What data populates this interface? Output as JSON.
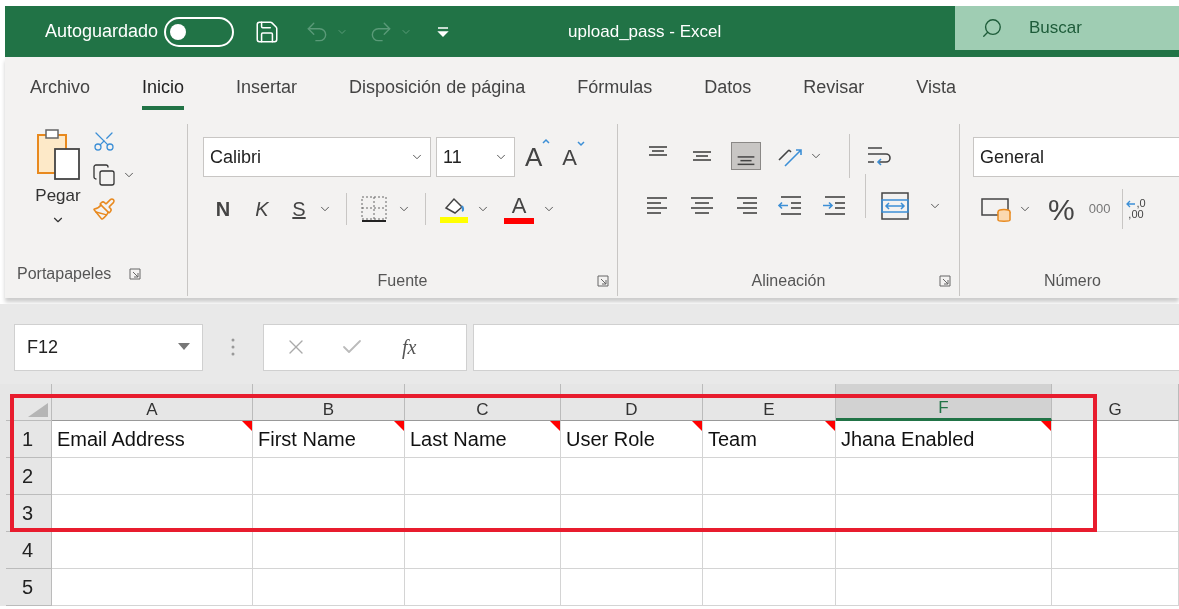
{
  "title_bar": {
    "autosave_label": "Autoguardado",
    "autosave_on": false,
    "undo_disabled": true,
    "redo_disabled": true,
    "title": "upload_pass  -  Excel",
    "search_label": "Buscar"
  },
  "tabs": [
    {
      "label": "Archivo",
      "selected": false
    },
    {
      "label": "Inicio",
      "selected": true
    },
    {
      "label": "Insertar",
      "selected": false
    },
    {
      "label": "Disposición de página",
      "selected": false
    },
    {
      "label": "Fórmulas",
      "selected": false
    },
    {
      "label": "Datos",
      "selected": false
    },
    {
      "label": "Revisar",
      "selected": false
    },
    {
      "label": "Vista",
      "selected": false
    }
  ],
  "ribbon": {
    "clipboard": {
      "paste_label": "Pegar",
      "group_label": "Portapapeles"
    },
    "font": {
      "font_name": "Calibri",
      "font_size": "11",
      "grow_label": "A",
      "shrink_label": "A",
      "bold_label": "N",
      "italic_label": "K",
      "underline_label": "S",
      "font_color_label": "A",
      "group_label": "Fuente"
    },
    "alignment": {
      "vertical": [
        {
          "kind": "top",
          "selected": false
        },
        {
          "kind": "middle",
          "selected": false
        },
        {
          "kind": "bottom",
          "selected": true
        }
      ],
      "group_label": "Alineación"
    },
    "number": {
      "format": "General",
      "percent_label": "%",
      "thousands_label": "000",
      "decimal_top": ",0",
      "decimal_bottom": ",00",
      "group_label": "Número"
    }
  },
  "formula_bar": {
    "name_box": "F12",
    "fx_label": "fx"
  },
  "sheet": {
    "columns": [
      {
        "label": "A",
        "selected": false
      },
      {
        "label": "B",
        "selected": false
      },
      {
        "label": "C",
        "selected": false
      },
      {
        "label": "D",
        "selected": false
      },
      {
        "label": "E",
        "selected": false
      },
      {
        "label": "F",
        "selected": true
      },
      {
        "label": "G",
        "selected": false
      }
    ],
    "rows": [
      {
        "label": "1",
        "cells": [
          {
            "text": "Email Address",
            "comment": true
          },
          {
            "text": "First Name",
            "comment": true
          },
          {
            "text": "Last Name",
            "comment": true
          },
          {
            "text": "User Role",
            "comment": true
          },
          {
            "text": "Team",
            "comment": true
          },
          {
            "text": "Jhana Enabled",
            "comment": true
          }
        ]
      },
      {
        "label": "2"
      },
      {
        "label": "3"
      },
      {
        "label": "4"
      },
      {
        "label": "5"
      }
    ]
  }
}
